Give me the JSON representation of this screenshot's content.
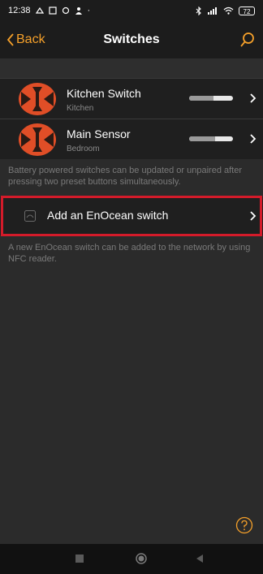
{
  "status_bar": {
    "time": "12:38",
    "battery": "72"
  },
  "navbar": {
    "back_label": "Back",
    "title": "Switches"
  },
  "devices": [
    {
      "name": "Kitchen Switch",
      "room": "Kitchen",
      "level": 0.55
    },
    {
      "name": "Main Sensor",
      "room": "Bedroom",
      "level": 0.6
    }
  ],
  "battery_info": "Battery powered switches can be updated or unpaired after pressing two preset buttons simultaneously.",
  "add_switch_label": "Add an EnOcean switch",
  "nfc_info": "A new EnOcean switch can be added to the network by using NFC reader.",
  "colors": {
    "accent": "#f5a02a",
    "highlight": "#d41b2a",
    "background": "#2b2b2b"
  }
}
